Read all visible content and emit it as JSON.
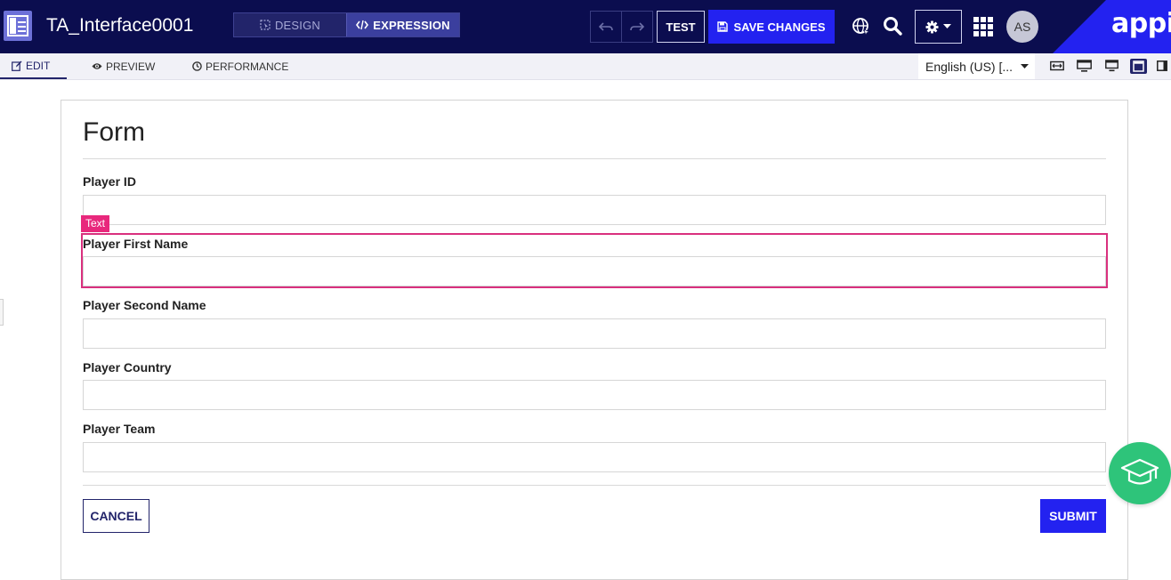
{
  "header": {
    "app_title": "TA_Interface0001",
    "modes": {
      "design": "DESIGN",
      "expression": "EXPRESSION"
    },
    "test_label": "TEST",
    "save_label": "SAVE CHANGES",
    "user_initials": "AS",
    "brand": "appia"
  },
  "subbar": {
    "tabs": {
      "edit": "EDIT",
      "preview": "PREVIEW",
      "performance": "PERFORMANCE"
    },
    "locale": "English (US) [..."
  },
  "form": {
    "title": "Form",
    "fields": [
      {
        "label": "Player ID",
        "value": ""
      },
      {
        "label": "Player First Name",
        "value": ""
      },
      {
        "label": "Player Second Name",
        "value": ""
      },
      {
        "label": "Player Country",
        "value": ""
      },
      {
        "label": "Player Team",
        "value": ""
      }
    ],
    "selected_component_tag": "Text",
    "cancel_label": "CANCEL",
    "submit_label": "SUBMIT"
  },
  "colors": {
    "header_bg": "#0b0d4f",
    "accent": "#2322f0",
    "selection": "#e8287c",
    "help_fab": "#2ec47a"
  },
  "icons": [
    "app-layout-icon",
    "design-icon",
    "code-icon",
    "undo-icon",
    "redo-icon",
    "save-icon",
    "globe-icon",
    "search-icon",
    "gear-icon",
    "chevron-down-icon",
    "app-grid-icon",
    "edit-icon",
    "eye-icon",
    "performance-icon",
    "fit-width-icon",
    "desktop-icon",
    "monitor-icon",
    "tablet-icon",
    "phone-icon",
    "graduation-cap-icon"
  ]
}
